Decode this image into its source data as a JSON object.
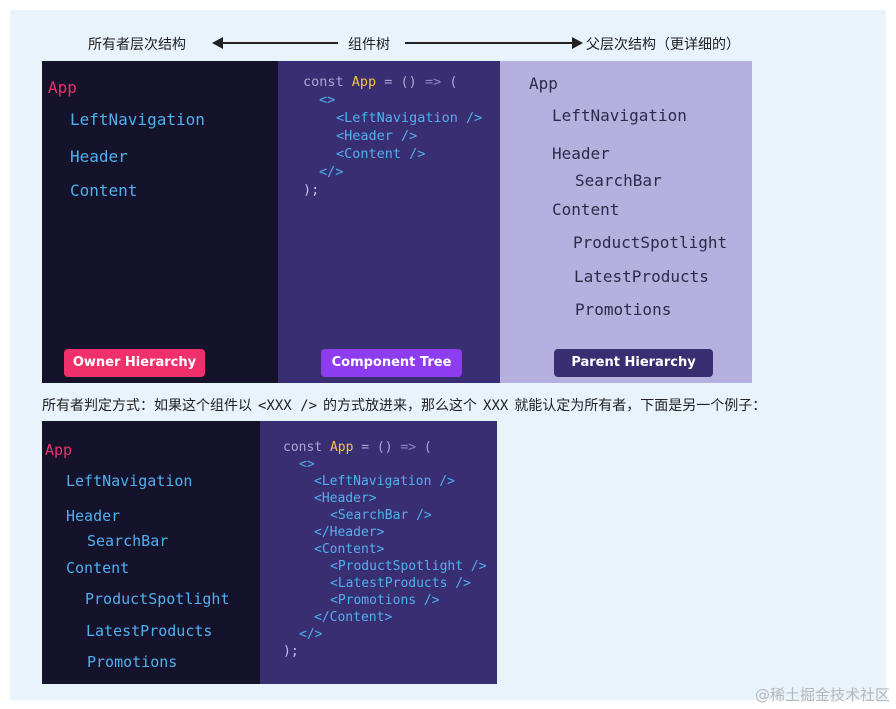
{
  "header": {
    "left_label": "所有者层次结构",
    "center_label": "组件树",
    "right_label": "父层次结构（更详细的）"
  },
  "figure1": {
    "owner": {
      "app": "App",
      "items": [
        "LeftNavigation",
        "Header",
        "Content"
      ],
      "badge": "Owner Hierarchy"
    },
    "code": {
      "lines": [
        {
          "text": "const App = () => ("
        },
        {
          "text": "<>"
        },
        {
          "text": "<LeftNavigation />"
        },
        {
          "text": "<Header />"
        },
        {
          "text": "<Content />"
        },
        {
          "text": "</>"
        },
        {
          "text": ");"
        }
      ],
      "badge": "Component Tree"
    },
    "parent": {
      "items": [
        "App",
        "LeftNavigation",
        "Header",
        "SearchBar",
        "Content",
        "ProductSpotlight",
        "LatestProducts",
        "Promotions"
      ],
      "badge": "Parent Hierarchy"
    }
  },
  "description": {
    "before": "所有者判定方式：如果这个组件以",
    "code1": "<XXX />",
    "middle": "的方式放进来，那么这个",
    "code2": "XXX",
    "after": "就能认定为所有者，下面是另一个例子："
  },
  "figure2": {
    "owner": {
      "app": "App",
      "items": [
        "LeftNavigation",
        "Header",
        "SearchBar",
        "Content",
        "ProductSpotlight",
        "LatestProducts",
        "Promotions"
      ]
    },
    "code": {
      "lines": [
        "const App = () => (",
        "<>",
        "<LeftNavigation />",
        "<Header>",
        "<SearchBar />",
        "</Header>",
        "<Content>",
        "<ProductSpotlight />",
        "<LatestProducts />",
        "<Promotions />",
        "</Content>",
        "</>",
        ");"
      ]
    }
  },
  "watermark": "@稀土掘金技术社区",
  "colors": {
    "app_pink": "#ee2f6b",
    "node_blue": "#4fb0ee",
    "owner_bg": "#15132b",
    "code_bg": "#3a2e73",
    "parent_bg": "#b5b0de",
    "badge_pink": "#f0306b",
    "badge_purple": "#8e3cf0",
    "badge_indigo": "#3a2e73",
    "frame_bg": "#e8f3fc"
  }
}
